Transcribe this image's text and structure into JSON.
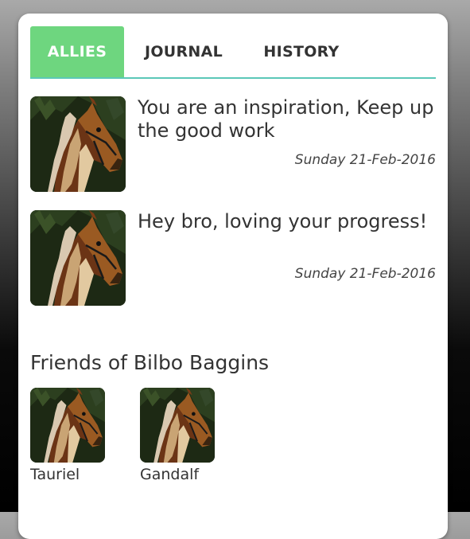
{
  "tabs": [
    {
      "label": "ALLIES",
      "active": true
    },
    {
      "label": "JOURNAL",
      "active": false
    },
    {
      "label": "HISTORY",
      "active": false
    }
  ],
  "messages": [
    {
      "text": "You are an inspiration, Keep up the good work",
      "date": "Sunday 21-Feb-2016",
      "avatar_icon": "horse-avatar-icon"
    },
    {
      "text": "Hey bro, loving your progress!",
      "date": "Sunday 21-Feb-2016",
      "avatar_icon": "horse-avatar-icon"
    }
  ],
  "friends": {
    "title": "Friends of Bilbo Baggins",
    "items": [
      {
        "name": "Tauriel",
        "avatar_icon": "horse-avatar-icon"
      },
      {
        "name": "Gandalf",
        "avatar_icon": "horse-avatar-icon"
      }
    ]
  },
  "colors": {
    "active_tab": "#6ed67f",
    "tab_underline": "#5cc8b8",
    "text": "#333333"
  }
}
